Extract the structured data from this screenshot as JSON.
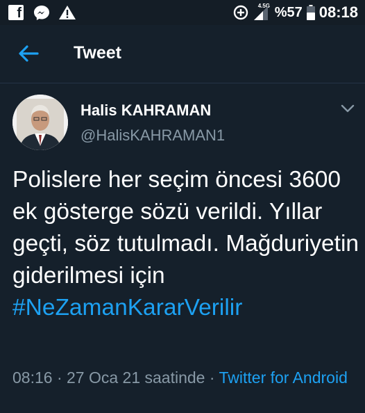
{
  "status_bar": {
    "network": "4.5G",
    "battery": "%57",
    "time": "08:18"
  },
  "header": {
    "title": "Tweet"
  },
  "tweet": {
    "author_name": "Halis KAHRAMAN",
    "author_handle": "@HalisKAHRAMAN1",
    "text": "Polislere her seçim öncesi 3600 ek gösterge sözü verildi. Yıllar geçti, söz tutulmadı. Mağduriyetin giderilmesi için",
    "hashtag": "#NeZamanKararVerilir",
    "timestamp": "08:16 · 27 Oca 21 saatinde · ",
    "source": "Twitter for Android"
  },
  "colors": {
    "background": "#15202b",
    "accent": "#1da1f2",
    "secondary_text": "#8899a6"
  },
  "icons": [
    "facebook-icon",
    "messenger-icon",
    "warning-icon",
    "data-saver-icon",
    "signal-icon",
    "battery-icon",
    "back-arrow-icon",
    "chevron-down-icon"
  ]
}
